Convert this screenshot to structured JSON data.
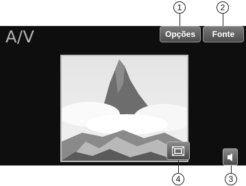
{
  "screen": {
    "title": "A/V",
    "options_label": "Opções",
    "font_label": "Fonte"
  },
  "callouts": [
    "1",
    "2",
    "3",
    "4"
  ],
  "icons": {
    "fullscreen": "fullscreen-icon",
    "volume": "speaker-icon"
  }
}
